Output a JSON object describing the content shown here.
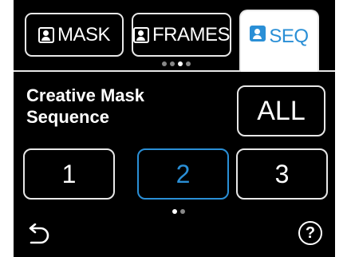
{
  "tabs": [
    {
      "label": "MASK",
      "icon": "user-icon",
      "active": false
    },
    {
      "label": "FRAMES",
      "icon": "user-icon",
      "active": false
    },
    {
      "label": "SEQ",
      "icon": "user-icon",
      "active": true
    }
  ],
  "tab_pager": {
    "count": 4,
    "active_index": 2
  },
  "title_line1": "Creative Mask",
  "title_line2": "Sequence",
  "all_button": "ALL",
  "sequence_buttons": [
    {
      "label": "1",
      "selected": false
    },
    {
      "label": "2",
      "selected": true
    },
    {
      "label": "3",
      "selected": false
    }
  ],
  "content_pager": {
    "count": 2,
    "active_index": 0
  },
  "footer": {
    "back_icon": "back-arrow-icon",
    "help_label": "?"
  },
  "colors": {
    "accent": "#2a8fd6",
    "background": "#000000",
    "foreground": "#ffffff"
  }
}
